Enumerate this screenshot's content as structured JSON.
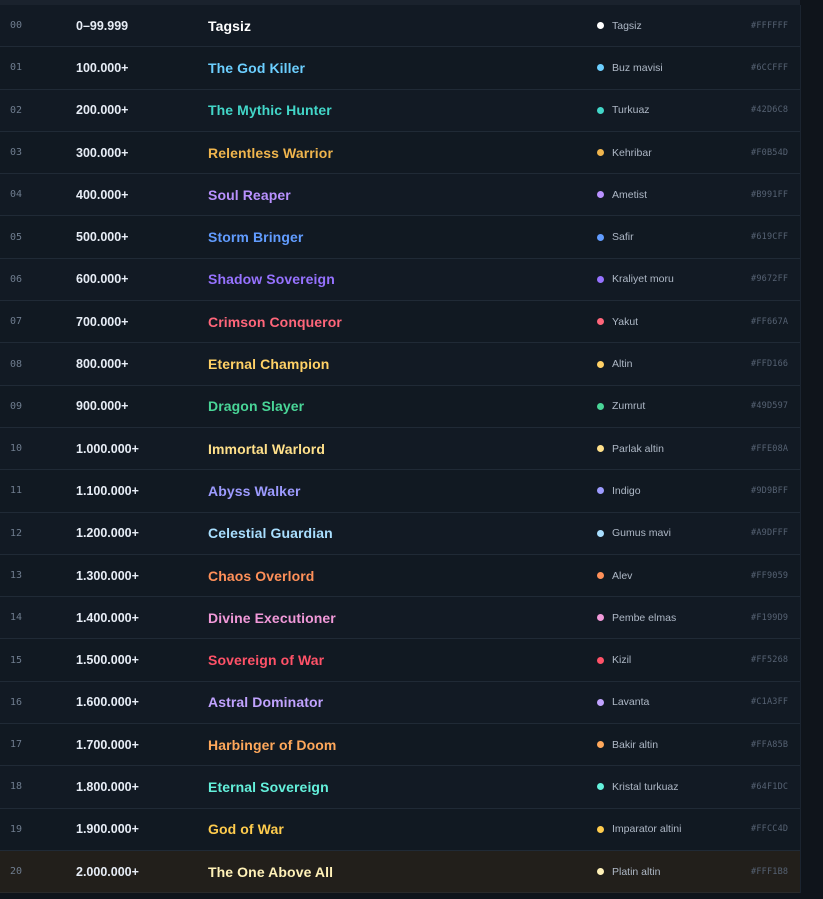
{
  "rows": [
    {
      "idx": "00",
      "range": "0–99.999",
      "title": "Tagsiz",
      "color_name": "Tagsiz",
      "hex": "#FFFFFF",
      "color": "#FFFFFF"
    },
    {
      "idx": "01",
      "range": "100.000+",
      "title": "The God Killer",
      "color_name": "Buz mavisi",
      "hex": "#6CCFFF",
      "color": "#6CCFFF"
    },
    {
      "idx": "02",
      "range": "200.000+",
      "title": "The Mythic Hunter",
      "color_name": "Turkuaz",
      "hex": "#42D6C8",
      "color": "#42D6C8"
    },
    {
      "idx": "03",
      "range": "300.000+",
      "title": "Relentless Warrior",
      "color_name": "Kehribar",
      "hex": "#F0B54D",
      "color": "#F0B54D"
    },
    {
      "idx": "04",
      "range": "400.000+",
      "title": "Soul Reaper",
      "color_name": "Ametist",
      "hex": "#B991FF",
      "color": "#B991FF"
    },
    {
      "idx": "05",
      "range": "500.000+",
      "title": "Storm Bringer",
      "color_name": "Safir",
      "hex": "#619CFF",
      "color": "#619CFF"
    },
    {
      "idx": "06",
      "range": "600.000+",
      "title": "Shadow Sovereign",
      "color_name": "Kraliyet moru",
      "hex": "#9672FF",
      "color": "#9672FF"
    },
    {
      "idx": "07",
      "range": "700.000+",
      "title": "Crimson Conqueror",
      "color_name": "Yakut",
      "hex": "#FF667A",
      "color": "#FF667A"
    },
    {
      "idx": "08",
      "range": "800.000+",
      "title": "Eternal Champion",
      "color_name": "Altin",
      "hex": "#FFD166",
      "color": "#FFD166"
    },
    {
      "idx": "09",
      "range": "900.000+",
      "title": "Dragon Slayer",
      "color_name": "Zumrut",
      "hex": "#49D597",
      "color": "#49D597"
    },
    {
      "idx": "10",
      "range": "1.000.000+",
      "title": "Immortal Warlord",
      "color_name": "Parlak altin",
      "hex": "#FFE08A",
      "color": "#FFE08A"
    },
    {
      "idx": "11",
      "range": "1.100.000+",
      "title": "Abyss Walker",
      "color_name": "Indigo",
      "hex": "#9D9BFF",
      "color": "#9D9BFF"
    },
    {
      "idx": "12",
      "range": "1.200.000+",
      "title": "Celestial Guardian",
      "color_name": "Gumus mavi",
      "hex": "#A9DFFF",
      "color": "#A9DFFF"
    },
    {
      "idx": "13",
      "range": "1.300.000+",
      "title": "Chaos Overlord",
      "color_name": "Alev",
      "hex": "#FF9059",
      "color": "#FF9059"
    },
    {
      "idx": "14",
      "range": "1.400.000+",
      "title": "Divine Executioner",
      "color_name": "Pembe elmas",
      "hex": "#F199D9",
      "color": "#F199D9"
    },
    {
      "idx": "15",
      "range": "1.500.000+",
      "title": "Sovereign of War",
      "color_name": "Kizil",
      "hex": "#FF5268",
      "color": "#FF5268"
    },
    {
      "idx": "16",
      "range": "1.600.000+",
      "title": "Astral Dominator",
      "color_name": "Lavanta",
      "hex": "#C1A3FF",
      "color": "#C1A3FF"
    },
    {
      "idx": "17",
      "range": "1.700.000+",
      "title": "Harbinger of Doom",
      "color_name": "Bakir altin",
      "hex": "#FFA85B",
      "color": "#FFA85B"
    },
    {
      "idx": "18",
      "range": "1.800.000+",
      "title": "Eternal Sovereign",
      "color_name": "Kristal turkuaz",
      "hex": "#64F1DC",
      "color": "#64F1DC"
    },
    {
      "idx": "19",
      "range": "1.900.000+",
      "title": "God of War",
      "color_name": "Imparator altini",
      "hex": "#FFCC4D",
      "color": "#FFCC4D"
    },
    {
      "idx": "20",
      "range": "2.000.000+",
      "title": "The One Above All",
      "color_name": "Platin altin",
      "hex": "#FFF1B8",
      "color": "#FFF1B8"
    }
  ]
}
